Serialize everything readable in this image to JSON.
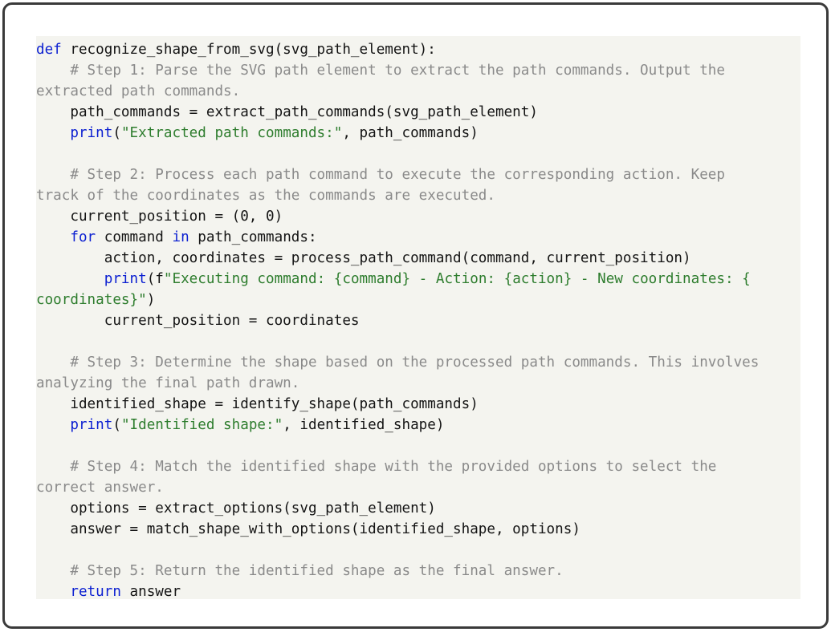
{
  "code": {
    "language": "python",
    "lines": [
      [
        {
          "t": "def",
          "c": "kw"
        },
        {
          "t": " recognize_shape_from_svg(svg_path_element):",
          "c": "plain"
        }
      ],
      [
        {
          "t": "    # Step 1: Parse the SVG path element to extract the path commands. Output the",
          "c": "comment"
        }
      ],
      [
        {
          "t": "extracted path commands.",
          "c": "comment"
        }
      ],
      [
        {
          "t": "    path_commands = extract_path_commands(svg_path_element)",
          "c": "plain"
        }
      ],
      [
        {
          "t": "    ",
          "c": "plain"
        },
        {
          "t": "print",
          "c": "kw"
        },
        {
          "t": "(",
          "c": "plain"
        },
        {
          "t": "\"Extracted path commands:\"",
          "c": "str"
        },
        {
          "t": ", path_commands)",
          "c": "plain"
        }
      ],
      [],
      [
        {
          "t": "    # Step 2: Process each path command to execute the corresponding action. Keep",
          "c": "comment"
        }
      ],
      [
        {
          "t": "track of the coordinates as the commands are executed.",
          "c": "comment"
        }
      ],
      [
        {
          "t": "    current_position = (0, 0)",
          "c": "plain"
        }
      ],
      [
        {
          "t": "    ",
          "c": "plain"
        },
        {
          "t": "for",
          "c": "kw"
        },
        {
          "t": " command ",
          "c": "plain"
        },
        {
          "t": "in",
          "c": "kw"
        },
        {
          "t": " path_commands:",
          "c": "plain"
        }
      ],
      [
        {
          "t": "        action, coordinates = process_path_command(command, current_position)",
          "c": "plain"
        }
      ],
      [
        {
          "t": "        ",
          "c": "plain"
        },
        {
          "t": "print",
          "c": "kw"
        },
        {
          "t": "(f",
          "c": "plain"
        },
        {
          "t": "\"Executing command: {command} - Action: {action} - New coordinates: {",
          "c": "str"
        }
      ],
      [
        {
          "t": "coordinates}\"",
          "c": "str"
        },
        {
          "t": ")",
          "c": "plain"
        }
      ],
      [
        {
          "t": "        current_position = coordinates",
          "c": "plain"
        }
      ],
      [],
      [
        {
          "t": "    # Step 3: Determine the shape based on the processed path commands. This involves",
          "c": "comment"
        }
      ],
      [
        {
          "t": "analyzing the final path drawn.",
          "c": "comment"
        }
      ],
      [
        {
          "t": "    identified_shape = identify_shape(path_commands)",
          "c": "plain"
        }
      ],
      [
        {
          "t": "    ",
          "c": "plain"
        },
        {
          "t": "print",
          "c": "kw"
        },
        {
          "t": "(",
          "c": "plain"
        },
        {
          "t": "\"Identified shape:\"",
          "c": "str"
        },
        {
          "t": ", identified_shape)",
          "c": "plain"
        }
      ],
      [],
      [
        {
          "t": "    # Step 4: Match the identified shape with the provided options to select the",
          "c": "comment"
        }
      ],
      [
        {
          "t": "correct answer.",
          "c": "comment"
        }
      ],
      [
        {
          "t": "    options = extract_options(svg_path_element)",
          "c": "plain"
        }
      ],
      [
        {
          "t": "    answer = match_shape_with_options(identified_shape, options)",
          "c": "plain"
        }
      ],
      [],
      [
        {
          "t": "    # Step 5: Return the identified shape as the final answer.",
          "c": "comment"
        }
      ],
      [
        {
          "t": "    ",
          "c": "plain"
        },
        {
          "t": "return",
          "c": "kw"
        },
        {
          "t": " answer",
          "c": "plain"
        }
      ]
    ]
  },
  "colors": {
    "background": "#ffffff",
    "frame_border": "#3a3a3a",
    "code_background": "#f4f4ef",
    "text": "#141414",
    "comment": "#8a8a8a",
    "keyword": "#0b1fd1",
    "string": "#2e7d2e"
  }
}
